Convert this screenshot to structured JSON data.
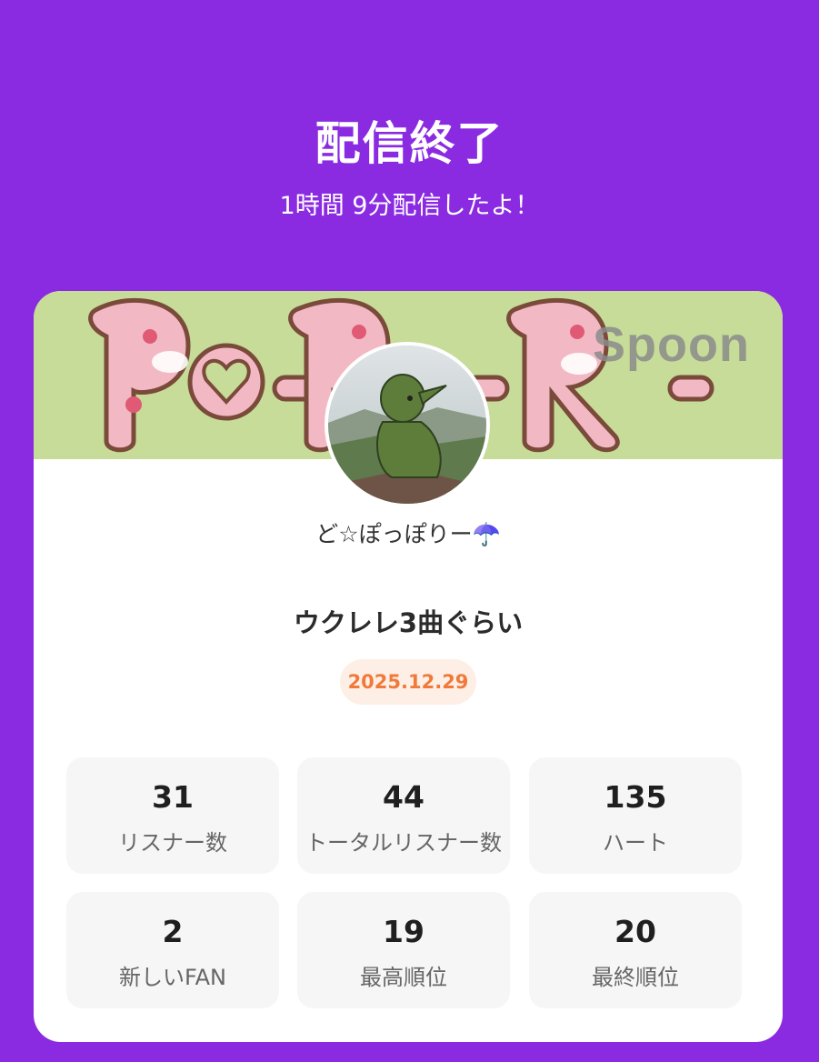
{
  "header": {
    "title": "配信終了",
    "subtitle": "1時間 9分配信したよ！"
  },
  "banner": {
    "watermark": "Spoon",
    "text": "Po-Po-Ri-"
  },
  "profile": {
    "username": "ど☆ぽっぽりー☂️"
  },
  "cast": {
    "title": "ウクレレ3曲ぐらい",
    "date": "2025.12.29"
  },
  "stats": [
    {
      "value": "31",
      "label": "リスナー数"
    },
    {
      "value": "44",
      "label": "トータルリスナー数"
    },
    {
      "value": "135",
      "label": "ハート"
    },
    {
      "value": "2",
      "label": "新しいFAN"
    },
    {
      "value": "19",
      "label": "最高順位"
    },
    {
      "value": "20",
      "label": "最終順位"
    }
  ],
  "colors": {
    "background": "#8a2be2",
    "accent_date": "#f07a3a",
    "banner_bg": "#c6dc98"
  }
}
